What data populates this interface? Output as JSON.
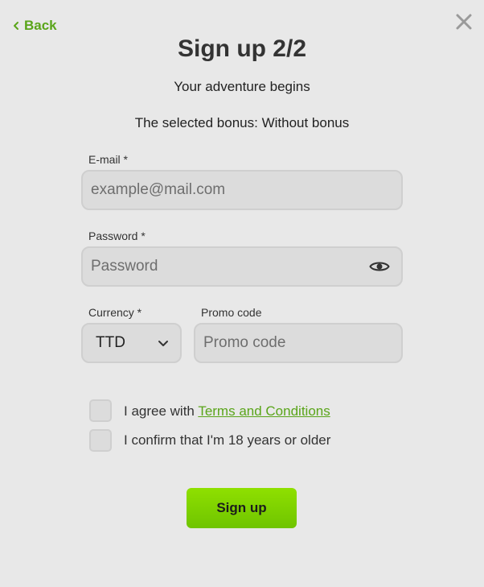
{
  "header": {
    "back_label": "Back",
    "title": "Sign up 2/2",
    "subtitle": "Your adventure begins",
    "bonus_text": "The selected bonus: Without bonus"
  },
  "form": {
    "email": {
      "label": "E-mail *",
      "placeholder": "example@mail.com",
      "value": ""
    },
    "password": {
      "label": "Password *",
      "placeholder": "Password",
      "value": ""
    },
    "currency": {
      "label": "Currency *",
      "value": "TTD"
    },
    "promo": {
      "label": "Promo code",
      "placeholder": "Promo code",
      "value": ""
    }
  },
  "agreements": {
    "terms_prefix": "I agree with",
    "terms_link": "Terms and Conditions",
    "age_text": "I confirm that I'm 18 years or older"
  },
  "actions": {
    "signup_label": "Sign up"
  },
  "icons": {
    "back": "chevron-left-icon",
    "close": "close-icon",
    "password_toggle": "eye-icon",
    "currency_dropdown": "chevron-down-icon"
  },
  "colors": {
    "accent": "#5aa51a",
    "button": "#7fd300",
    "background": "#e8e8e8",
    "field": "#dcdcdc"
  }
}
